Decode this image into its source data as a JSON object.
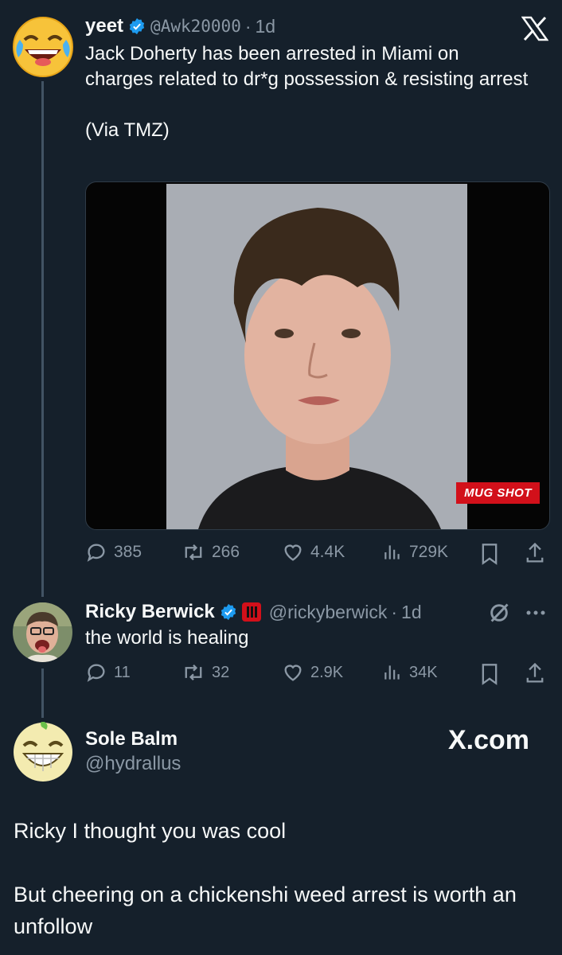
{
  "tweet1": {
    "name": "yeet",
    "handle": "@Awk20000",
    "time": "1d",
    "text": "Jack Doherty has been arrested in Miami on charges related to dr*g possession & resisting arrest\n\n(Via TMZ)",
    "media_badge": "MUG SHOT",
    "stats": {
      "replies": "385",
      "reposts": "266",
      "likes": "4.4K",
      "views": "729K"
    }
  },
  "tweet2": {
    "name": "Ricky Berwick",
    "handle": "@rickyberwick",
    "time": "1d",
    "text": "the world is healing",
    "stats": {
      "replies": "11",
      "reposts": "32",
      "likes": "2.9K",
      "views": "34K"
    }
  },
  "tweet3": {
    "name": "Sole Balm",
    "handle": "@hydrallus",
    "watermark": "X.com",
    "text": "Ricky I thought you was cool\n\nBut cheering on a chickenshi weed arrest is worth an unfollow"
  },
  "colors": {
    "background": "#15202b",
    "verified": "#1d9bf0",
    "muted": "#8b98a5",
    "badge": "#d2101a"
  },
  "icons": [
    "x-logo-icon",
    "verified-icon",
    "reply-icon",
    "repost-icon",
    "like-icon",
    "views-icon",
    "bookmark-icon",
    "share-icon",
    "more-icon",
    "grok-icon"
  ]
}
